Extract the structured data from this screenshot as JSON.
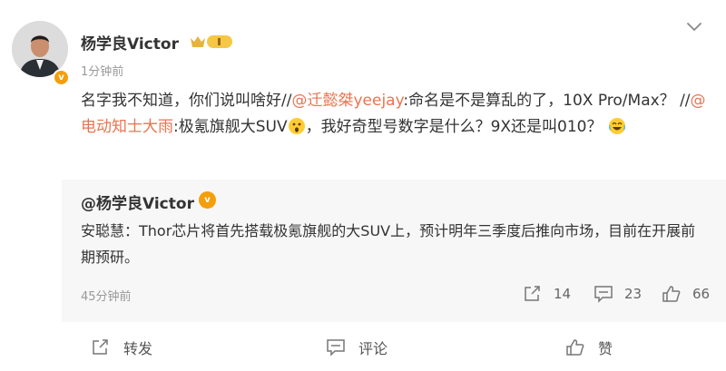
{
  "post": {
    "username": "杨学良Victor",
    "time": "1分钟前",
    "verified_badge": "v",
    "text_parts": {
      "p1": "名字我不知道，你们说叫啥好//",
      "m1": "@迁懿桀yeejay",
      "p2": ":命名是不是算乱的了，10X Pro/Max？ //",
      "m2": "@电动知士大雨",
      "p3": ":极氪旗舰大SUV",
      "p4": "，我好奇型号数字是什么？9X还是叫010？"
    }
  },
  "repost": {
    "username": "@杨学良Victor",
    "verified_badge": "v",
    "text": "安聪慧：Thor芯片将首先搭载极氪旗舰的大SUV上，预计明年三季度后推向市场，目前在开展前期预研。",
    "time": "45分钟前",
    "stats": {
      "reposts": "14",
      "comments": "23",
      "likes": "66"
    }
  },
  "actions": {
    "repost_label": "转发",
    "comment_label": "评论",
    "like_label": "赞"
  },
  "icons": {
    "more": "chevron-down-icon",
    "repost": "share-icon",
    "comment": "comment-icon",
    "like": "thumbs-up-icon",
    "emoji1": "surprised-emoji-icon",
    "emoji2": "laughing-emoji-icon"
  },
  "colors": {
    "mention": "#eb7350",
    "verified": "#f59e0b",
    "repost_bg": "#f7f7f7",
    "muted": "#999999"
  }
}
